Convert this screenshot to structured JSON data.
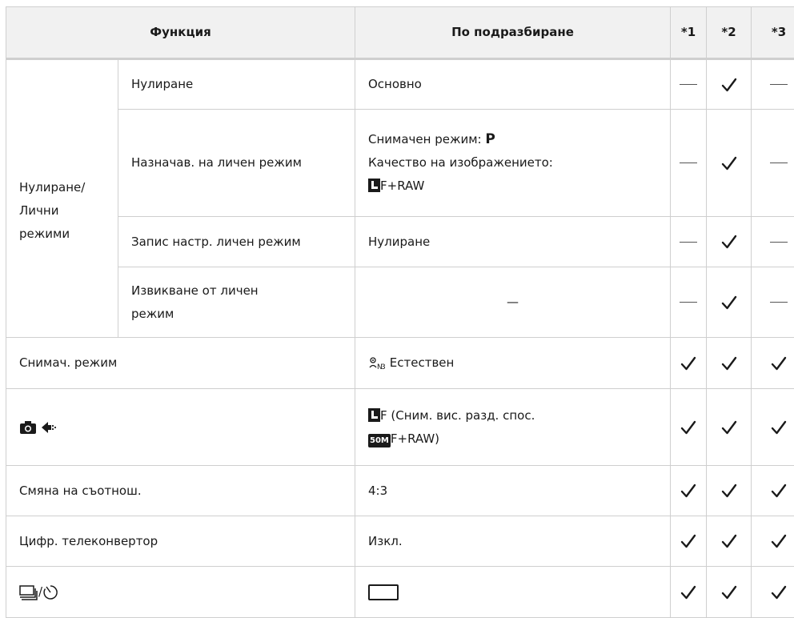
{
  "header": {
    "function": "Функция",
    "default": "По подразбиране",
    "col1": "*1",
    "col2": "*2",
    "col3": "*3"
  },
  "group": {
    "label_line1": "Нулиране/",
    "label_line2": "Лични",
    "label_line3": "режими"
  },
  "rows": {
    "reset": {
      "name": "Нулиране",
      "default": "Основно",
      "c1": "—",
      "c3": "—"
    },
    "assign": {
      "name": "Назначав. на личен режим",
      "default_line1": "Снимачен режим:",
      "default_mode": "P",
      "default_line2": "Качество на изображението:",
      "default_line3": "F+RAW",
      "c1": "—",
      "c3": "—"
    },
    "save": {
      "name": "Запис настр. личен режим",
      "default": "Нулиране",
      "c1": "—",
      "c3": "—"
    },
    "recall": {
      "name_line1": "Извикване от личен",
      "name_line2": "режим",
      "default": "—",
      "c1": "—",
      "c3": "—"
    },
    "picture_mode": {
      "name": "Снимач. режим",
      "default": "Естествен"
    },
    "quality": {
      "default_line1": "F (Сним. вис. разд. спос.",
      "default_badge": "50M",
      "default_line2": "F+RAW)"
    },
    "aspect": {
      "name": "Смяна на съотнош.",
      "default": "4:3"
    },
    "teleconverter": {
      "name": "Цифр. телеконвертор",
      "default": "Изкл."
    },
    "drive": {
      "separator": "/"
    }
  },
  "icons": {
    "check": "check-icon",
    "camera": "camera-icon",
    "quality": "image-quality-icon",
    "picture_mode": "picture-mode-natural-icon",
    "drive": "sequential-shooting-icon",
    "self_timer": "self-timer-icon",
    "single": "single-frame-icon"
  }
}
